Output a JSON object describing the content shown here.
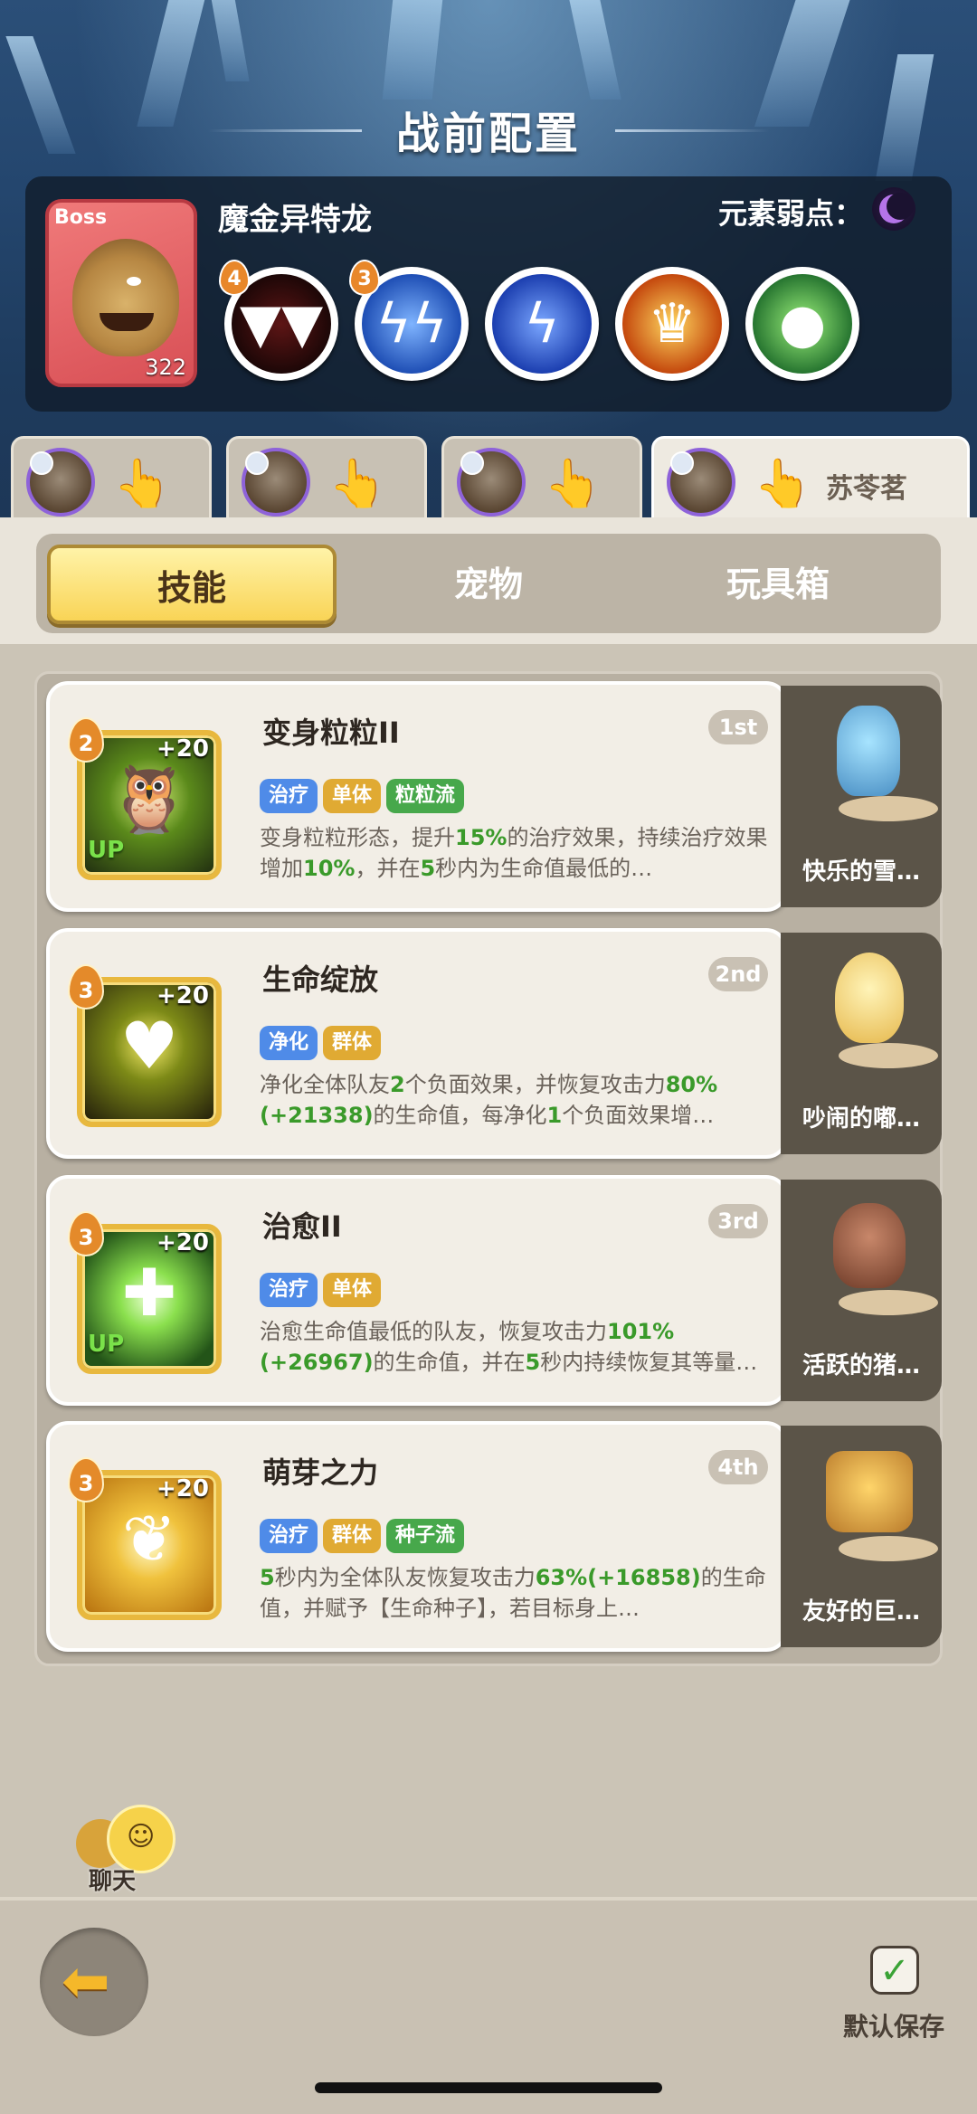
{
  "screen_title": "战前配置",
  "boss": {
    "tag": "Boss",
    "name": "魔金异特龙",
    "level": "322",
    "weakness_label": "元素弱点：",
    "weakness_icon": "moon-icon",
    "skills": [
      {
        "icon": "fangs-icon",
        "badge": "4"
      },
      {
        "icon": "lightning-claw-icon",
        "badge": "3"
      },
      {
        "icon": "lightning-bolt-icon",
        "badge": ""
      },
      {
        "icon": "golden-crown-icon",
        "badge": ""
      },
      {
        "icon": "green-slime-icon",
        "badge": ""
      }
    ]
  },
  "hero_tabs": [
    {
      "icon": "hero-avatar",
      "hand_icon": "tap-hand-icon",
      "name": ""
    },
    {
      "icon": "hero-avatar",
      "hand_icon": "tap-hand-icon",
      "name": ""
    },
    {
      "icon": "hero-avatar",
      "hand_icon": "tap-hand-icon",
      "name": ""
    },
    {
      "icon": "hero-avatar",
      "hand_icon": "tap-hand-icon",
      "name": "苏苓茗",
      "active": true
    }
  ],
  "segments": {
    "skills": "技能",
    "pets": "宠物",
    "toybox": "玩具箱",
    "active": "skills"
  },
  "skills": [
    {
      "title": "变身粒粒II",
      "rank": "1st",
      "level": "2",
      "plus": "+20",
      "up": "UP",
      "tags": [
        "治疗",
        "单体",
        "粒粒流"
      ],
      "desc": "变身粒粒形态，提升15%的治疗效果，持续治疗效果增加10%，并在5秒内为生命值最低的…",
      "pet": "快乐的雪…"
    },
    {
      "title": "生命绽放",
      "rank": "2nd",
      "level": "3",
      "plus": "+20",
      "up": "",
      "tags": [
        "净化",
        "群体"
      ],
      "desc": "净化全体队友2个负面效果，并恢复攻击力80%(+21338)的生命值，每净化1个负面效果增…",
      "pet": "吵闹的嘟…"
    },
    {
      "title": "治愈II",
      "rank": "3rd",
      "level": "3",
      "plus": "+20",
      "up": "UP",
      "tags": [
        "治疗",
        "单体"
      ],
      "desc": "治愈生命值最低的队友，恢复攻击力101%(+26967)的生命值，并在5秒内持续恢复其等量…",
      "pet": "活跃的猪…"
    },
    {
      "title": "萌芽之力",
      "rank": "4th",
      "level": "3",
      "plus": "+20",
      "up": "",
      "tags": [
        "治疗",
        "群体",
        "种子流"
      ],
      "desc": "5秒内为全体队友恢复攻击力63%(+16858)的生命值，并赋予【生命种子】，若目标身上…",
      "pet": "友好的巨…"
    }
  ],
  "chat_label": "聊天",
  "save_label": "默认保存",
  "colors": {
    "accent_yellow": "#f9d456",
    "tag_blue": "#4f8be8",
    "tag_gold": "#e0aa33",
    "tag_green": "#47a84b",
    "number_green": "#3a9a2a"
  }
}
